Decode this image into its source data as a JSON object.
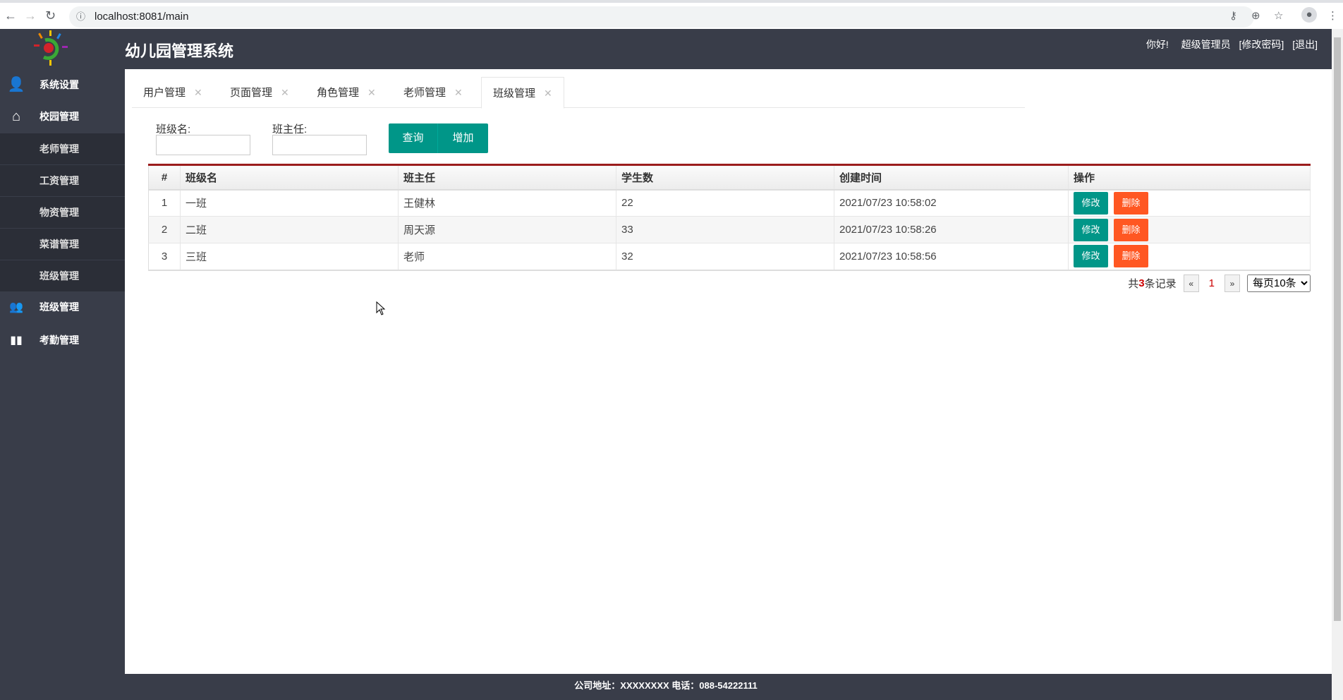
{
  "browser": {
    "url": "localhost:8081/main"
  },
  "header": {
    "title": "幼儿园管理系统",
    "greeting": "你好!",
    "user": "超级管理员",
    "change_password": "[修改密码]",
    "logout": "[退出]"
  },
  "sidebar": {
    "items": [
      {
        "label": "系统设置",
        "icon": "user-icon"
      },
      {
        "label": "校园管理",
        "icon": "home-icon"
      },
      {
        "label": "老师管理"
      },
      {
        "label": "工资管理"
      },
      {
        "label": "物资管理"
      },
      {
        "label": "菜谱管理"
      },
      {
        "label": "班级管理"
      },
      {
        "label": "班级管理",
        "icon": "group-icon"
      },
      {
        "label": "考勤管理",
        "icon": "bar-chart-icon"
      }
    ]
  },
  "tabs": [
    {
      "label": "用户管理"
    },
    {
      "label": "页面管理"
    },
    {
      "label": "角色管理"
    },
    {
      "label": "老师管理"
    },
    {
      "label": "班级管理",
      "active": true
    }
  ],
  "search": {
    "class_name_label": "班级名:",
    "teacher_label": "班主任:",
    "class_name_value": "",
    "teacher_value": "",
    "query_button": "查询",
    "add_button": "增加"
  },
  "table": {
    "headers": [
      "#",
      "班级名",
      "班主任",
      "学生数",
      "创建时间",
      "操作"
    ],
    "rows": [
      {
        "no": "1",
        "name": "一班",
        "teacher": "王健林",
        "students": "22",
        "created": "2021/07/23 10:58:02"
      },
      {
        "no": "2",
        "name": "二班",
        "teacher": "周天源",
        "students": "33",
        "created": "2021/07/23 10:58:26"
      },
      {
        "no": "3",
        "name": "三班",
        "teacher": "老师",
        "students": "32",
        "created": "2021/07/23 10:58:56"
      }
    ],
    "edit_label": "修改",
    "delete_label": "删除"
  },
  "pager": {
    "prefix": "共",
    "total": "3",
    "suffix": "条记录",
    "prev": "«",
    "page": "1",
    "next": "»",
    "page_size": "每页10条"
  },
  "footer": {
    "line1": "公司地址：XXXXXXXX 电话：088-54222111"
  },
  "colors": {
    "header": "#393d49",
    "primary": "#009688",
    "danger": "#ff5722",
    "accent": "#9b1c1c"
  }
}
